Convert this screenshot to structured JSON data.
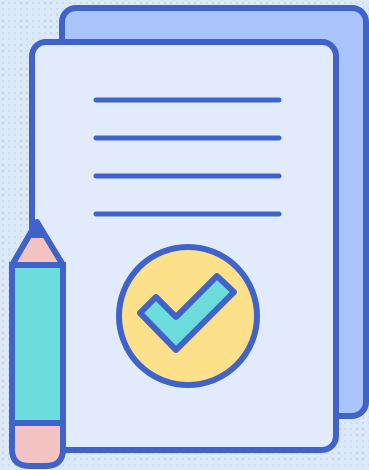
{
  "illustration": {
    "subject": "approved-document-with-pencil",
    "icons": [
      "document-icon",
      "checkmark-icon",
      "pencil-icon"
    ],
    "colors": {
      "outline": "#3f63c8",
      "back_sheet": "#a9c4fb",
      "front_sheet": "#e1ebfb",
      "text_lines": "#3f63c8",
      "check_badge": "#fde08a",
      "check_mark": "#6ddcdc",
      "pencil_body": "#6ddcdc",
      "pencil_tip": "#f4c4c4",
      "pencil_eraser": "#f4c4c4"
    }
  }
}
